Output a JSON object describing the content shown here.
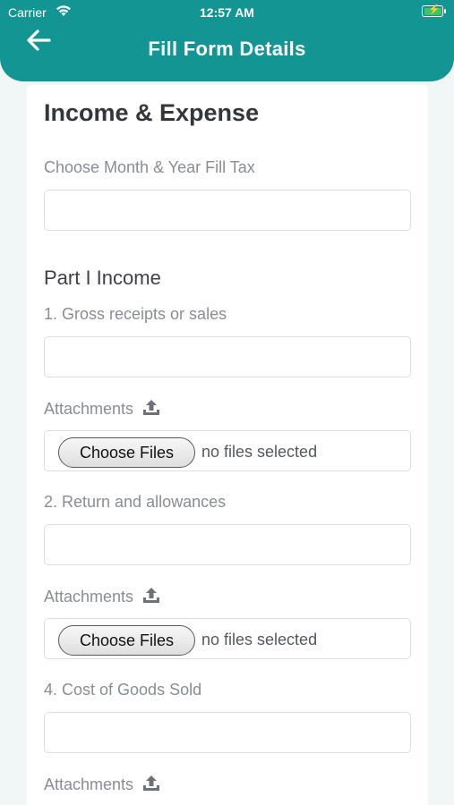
{
  "status_bar": {
    "carrier": "Carrier",
    "time": "12:57 AM"
  },
  "header": {
    "title": "Fill Form Details"
  },
  "form": {
    "section_title": "Income & Expense",
    "month_year_label": "Choose Month & Year Fill Tax",
    "part1_title": "Part I Income",
    "fields": [
      {
        "label": "1. Gross receipts or sales",
        "attach_label": "Attachments",
        "file_button": "Choose Files",
        "file_status": "no files selected"
      },
      {
        "label": "2. Return and allowances",
        "attach_label": "Attachments",
        "file_button": "Choose Files",
        "file_status": "no files selected"
      },
      {
        "label": "4. Cost of Goods Sold",
        "attach_label": "Attachments"
      }
    ]
  },
  "colors": {
    "primary": "#139693",
    "background": "#f1f6f6"
  }
}
